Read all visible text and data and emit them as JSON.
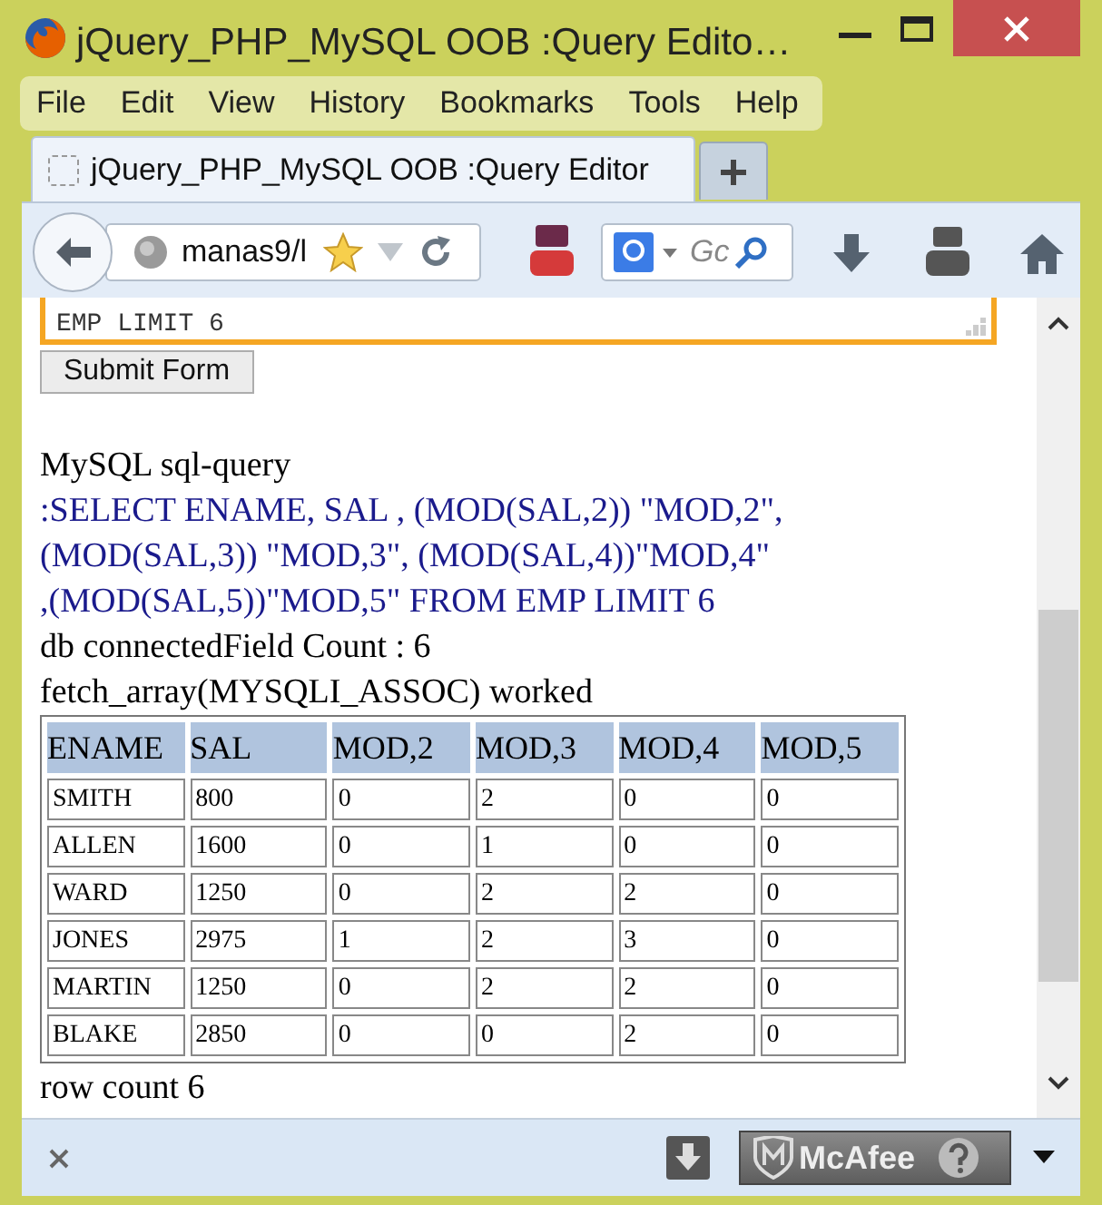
{
  "window": {
    "title": "jQuery_PHP_MySQL OOB :Query Edito…"
  },
  "menu": [
    "File",
    "Edit",
    "View",
    "History",
    "Bookmarks",
    "Tools",
    "Help"
  ],
  "tabs": [
    {
      "label": "jQuery_PHP_MySQL OOB :Query Editor",
      "selected": true
    }
  ],
  "toolbar": {
    "address": "manas9/l",
    "search_placeholder": "Gc"
  },
  "page": {
    "query_field": {
      "value": "EMP LIMIT 6"
    },
    "submit_button": "Submit Form",
    "lines": [
      {
        "kind": "plain",
        "text": "MySQL sql-query"
      },
      {
        "kind": "query",
        "text": ":SELECT ENAME, SAL , (MOD(SAL,2)) \"MOD,2\","
      },
      {
        "kind": "query",
        "text": "(MOD(SAL,3)) \"MOD,3\", (MOD(SAL,4))\"MOD,4\""
      },
      {
        "kind": "query",
        "text": ",(MOD(SAL,5))\"MOD,5\" FROM EMP LIMIT 6"
      },
      {
        "kind": "plain",
        "text": "db connectedField Count : 6"
      },
      {
        "kind": "plain",
        "text": "fetch_array(MYSQLI_ASSOC) worked"
      }
    ],
    "table": {
      "columns": [
        "ENAME",
        "SAL",
        "MOD,2",
        "MOD,3",
        "MOD,4",
        "MOD,5"
      ],
      "rows": [
        [
          "SMITH",
          "800",
          "0",
          "2",
          "0",
          "0"
        ],
        [
          "ALLEN",
          "1600",
          "0",
          "1",
          "0",
          "0"
        ],
        [
          "WARD",
          "1250",
          "0",
          "2",
          "2",
          "0"
        ],
        [
          "JONES",
          "2975",
          "1",
          "2",
          "3",
          "0"
        ],
        [
          "MARTIN",
          "1250",
          "0",
          "2",
          "2",
          "0"
        ],
        [
          "BLAKE",
          "2850",
          "0",
          "0",
          "2",
          "0"
        ]
      ]
    },
    "row_count": "row count 6"
  },
  "addon_bar": {
    "mcafee_label": "McAfee"
  }
}
